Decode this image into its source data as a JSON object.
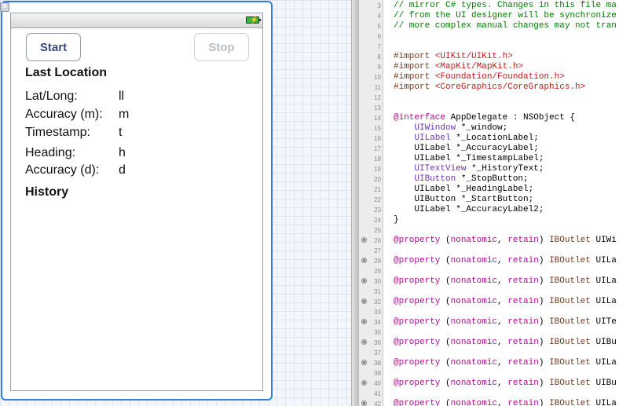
{
  "canvas": {
    "close_glyph": "×",
    "battery_glyph": "⚡",
    "buttons": {
      "start": "Start",
      "stop": "Stop"
    },
    "labels": {
      "last_location": "Last Location",
      "latlong": "Lat/Long:",
      "latlong_value": "ll",
      "accuracy_m": "Accuracy (m):",
      "accuracy_m_value": "m",
      "timestamp": "Timestamp:",
      "timestamp_value": "t",
      "heading": "Heading:",
      "heading_value": "h",
      "accuracy_d": "Accuracy (d):",
      "accuracy_d_value": "d",
      "history": "History"
    }
  },
  "editor": {
    "lines": [
      {
        "n": "3",
        "bp": false,
        "parts": [
          {
            "t": "// mirror C# types. Changes in this file ma",
            "c": "comment"
          }
        ]
      },
      {
        "n": "4",
        "bp": false,
        "parts": [
          {
            "t": "// from the UI designer will be synchronize",
            "c": "comment"
          }
        ]
      },
      {
        "n": "5",
        "bp": false,
        "parts": [
          {
            "t": "// more complex manual changes may not tran",
            "c": "comment"
          }
        ]
      },
      {
        "n": "6",
        "bp": false,
        "parts": []
      },
      {
        "n": "7",
        "bp": false,
        "parts": []
      },
      {
        "n": "8",
        "bp": false,
        "parts": [
          {
            "t": "#import ",
            "c": "pre"
          },
          {
            "t": "<UIKit/UIKit.h>",
            "c": "str"
          }
        ]
      },
      {
        "n": "9",
        "bp": false,
        "parts": [
          {
            "t": "#import ",
            "c": "pre"
          },
          {
            "t": "<MapKit/MapKit.h>",
            "c": "str"
          }
        ]
      },
      {
        "n": "10",
        "bp": false,
        "parts": [
          {
            "t": "#import ",
            "c": "pre"
          },
          {
            "t": "<Foundation/Foundation.h>",
            "c": "str"
          }
        ]
      },
      {
        "n": "11",
        "bp": false,
        "parts": [
          {
            "t": "#import ",
            "c": "pre"
          },
          {
            "t": "<CoreGraphics/CoreGraphics.h>",
            "c": "str"
          }
        ]
      },
      {
        "n": "12",
        "bp": false,
        "parts": []
      },
      {
        "n": "13",
        "bp": false,
        "parts": []
      },
      {
        "n": "14",
        "bp": false,
        "parts": [
          {
            "t": "@interface",
            "c": "kw"
          },
          {
            "t": " AppDelegate : NSObject {",
            "c": ""
          }
        ]
      },
      {
        "n": "15",
        "bp": false,
        "parts": [
          {
            "t": "    ",
            "c": ""
          },
          {
            "t": "UIWindow",
            "c": "type"
          },
          {
            "t": " *_window;",
            "c": ""
          }
        ]
      },
      {
        "n": "16",
        "bp": false,
        "parts": [
          {
            "t": "    ",
            "c": ""
          },
          {
            "t": "UILabel",
            "c": "type"
          },
          {
            "t": " *_LocationLabel;",
            "c": ""
          }
        ]
      },
      {
        "n": "17",
        "bp": false,
        "parts": [
          {
            "t": "    UILabel *_AccuracyLabel;",
            "c": ""
          }
        ]
      },
      {
        "n": "18",
        "bp": false,
        "parts": [
          {
            "t": "    UILabel *_TimestampLabel;",
            "c": ""
          }
        ]
      },
      {
        "n": "19",
        "bp": false,
        "parts": [
          {
            "t": "    ",
            "c": ""
          },
          {
            "t": "UITextView",
            "c": "type"
          },
          {
            "t": " *_HistoryText;",
            "c": ""
          }
        ]
      },
      {
        "n": "20",
        "bp": false,
        "parts": [
          {
            "t": "    ",
            "c": ""
          },
          {
            "t": "UIButton",
            "c": "type"
          },
          {
            "t": " *_StopButton;",
            "c": ""
          }
        ]
      },
      {
        "n": "21",
        "bp": false,
        "parts": [
          {
            "t": "    UILabel *_HeadingLabel;",
            "c": ""
          }
        ]
      },
      {
        "n": "22",
        "bp": false,
        "parts": [
          {
            "t": "    UIButton *_StartButton;",
            "c": ""
          }
        ]
      },
      {
        "n": "23",
        "bp": false,
        "parts": [
          {
            "t": "    UILabel *_AccuracyLabel2;",
            "c": ""
          }
        ]
      },
      {
        "n": "24",
        "bp": false,
        "parts": [
          {
            "t": "}",
            "c": ""
          }
        ]
      },
      {
        "n": "25",
        "bp": false,
        "parts": []
      },
      {
        "n": "26",
        "bp": true,
        "parts": [
          {
            "t": "@property",
            "c": "kw"
          },
          {
            "t": " (",
            "c": ""
          },
          {
            "t": "nonatomic",
            "c": "kw"
          },
          {
            "t": ", ",
            "c": ""
          },
          {
            "t": "retain",
            "c": "kw"
          },
          {
            "t": ") ",
            "c": ""
          },
          {
            "t": "IBOutlet",
            "c": "pre"
          },
          {
            "t": " UIWi",
            "c": ""
          }
        ]
      },
      {
        "n": "27",
        "bp": false,
        "parts": []
      },
      {
        "n": "28",
        "bp": true,
        "parts": [
          {
            "t": "@property",
            "c": "kw"
          },
          {
            "t": " (",
            "c": ""
          },
          {
            "t": "nonatomic",
            "c": "kw"
          },
          {
            "t": ", ",
            "c": ""
          },
          {
            "t": "retain",
            "c": "kw"
          },
          {
            "t": ") ",
            "c": ""
          },
          {
            "t": "IBOutlet",
            "c": "pre"
          },
          {
            "t": " UILa",
            "c": ""
          }
        ]
      },
      {
        "n": "29",
        "bp": false,
        "parts": []
      },
      {
        "n": "30",
        "bp": true,
        "parts": [
          {
            "t": "@property",
            "c": "kw"
          },
          {
            "t": " (",
            "c": ""
          },
          {
            "t": "nonatomic",
            "c": "kw"
          },
          {
            "t": ", ",
            "c": ""
          },
          {
            "t": "retain",
            "c": "kw"
          },
          {
            "t": ") ",
            "c": ""
          },
          {
            "t": "IBOutlet",
            "c": "pre"
          },
          {
            "t": " UILa",
            "c": ""
          }
        ]
      },
      {
        "n": "31",
        "bp": false,
        "parts": []
      },
      {
        "n": "32",
        "bp": true,
        "parts": [
          {
            "t": "@property",
            "c": "kw"
          },
          {
            "t": " (",
            "c": ""
          },
          {
            "t": "nonatomic",
            "c": "kw"
          },
          {
            "t": ", ",
            "c": ""
          },
          {
            "t": "retain",
            "c": "kw"
          },
          {
            "t": ") ",
            "c": ""
          },
          {
            "t": "IBOutlet",
            "c": "pre"
          },
          {
            "t": " UILa",
            "c": ""
          }
        ]
      },
      {
        "n": "33",
        "bp": false,
        "parts": []
      },
      {
        "n": "34",
        "bp": true,
        "parts": [
          {
            "t": "@property",
            "c": "kw"
          },
          {
            "t": " (",
            "c": ""
          },
          {
            "t": "nonatomic",
            "c": "kw"
          },
          {
            "t": ", ",
            "c": ""
          },
          {
            "t": "retain",
            "c": "kw"
          },
          {
            "t": ") ",
            "c": ""
          },
          {
            "t": "IBOutlet",
            "c": "pre"
          },
          {
            "t": " UITe",
            "c": ""
          }
        ]
      },
      {
        "n": "35",
        "bp": false,
        "parts": []
      },
      {
        "n": "36",
        "bp": true,
        "parts": [
          {
            "t": "@property",
            "c": "kw"
          },
          {
            "t": " (",
            "c": ""
          },
          {
            "t": "nonatomic",
            "c": "kw"
          },
          {
            "t": ", ",
            "c": ""
          },
          {
            "t": "retain",
            "c": "kw"
          },
          {
            "t": ") ",
            "c": ""
          },
          {
            "t": "IBOutlet",
            "c": "pre"
          },
          {
            "t": " UIBu",
            "c": ""
          }
        ]
      },
      {
        "n": "37",
        "bp": false,
        "parts": []
      },
      {
        "n": "38",
        "bp": true,
        "parts": [
          {
            "t": "@property",
            "c": "kw"
          },
          {
            "t": " (",
            "c": ""
          },
          {
            "t": "nonatomic",
            "c": "kw"
          },
          {
            "t": ", ",
            "c": ""
          },
          {
            "t": "retain",
            "c": "kw"
          },
          {
            "t": ") ",
            "c": ""
          },
          {
            "t": "IBOutlet",
            "c": "pre"
          },
          {
            "t": " UILa",
            "c": ""
          }
        ]
      },
      {
        "n": "39",
        "bp": false,
        "parts": []
      },
      {
        "n": "40",
        "bp": true,
        "parts": [
          {
            "t": "@property",
            "c": "kw"
          },
          {
            "t": " (",
            "c": ""
          },
          {
            "t": "nonatomic",
            "c": "kw"
          },
          {
            "t": ", ",
            "c": ""
          },
          {
            "t": "retain",
            "c": "kw"
          },
          {
            "t": ") ",
            "c": ""
          },
          {
            "t": "IBOutlet",
            "c": "pre"
          },
          {
            "t": " UIBu",
            "c": ""
          }
        ]
      },
      {
        "n": "41",
        "bp": false,
        "parts": []
      },
      {
        "n": "42",
        "bp": true,
        "parts": [
          {
            "t": "@property",
            "c": "kw"
          },
          {
            "t": " (",
            "c": ""
          },
          {
            "t": "nonatomic",
            "c": "kw"
          },
          {
            "t": ", ",
            "c": ""
          },
          {
            "t": "retain",
            "c": "kw"
          },
          {
            "t": ") ",
            "c": ""
          },
          {
            "t": "IBOutlet",
            "c": "pre"
          },
          {
            "t": " UILa",
            "c": ""
          }
        ]
      }
    ]
  }
}
